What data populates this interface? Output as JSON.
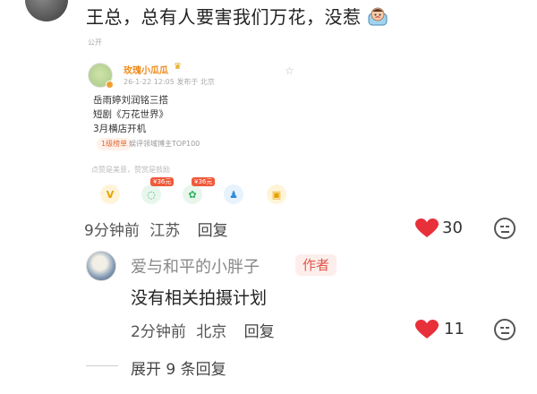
{
  "comment1": {
    "text": "王总，总有人要害我们万花，没惹",
    "time": "9分钟前",
    "location": "江苏",
    "reply_label": "回复",
    "like_count": "30"
  },
  "card": {
    "visibility": "公开",
    "user": "玫瑰小瓜瓜",
    "meta": "26-1-22 12:05 发布于 北京",
    "body_lines": [
      "岳雨婷刘润铭三搭",
      "短剧《万花世界》",
      "3月横店开机"
    ],
    "tag": "1级榜单",
    "rank": "娱评领域博主TOP100",
    "hint": "点赞是美意，赞赏是鼓励",
    "rewards": [
      {
        "icon": "v-pay-icon",
        "price": ""
      },
      {
        "icon": "wechat-icon",
        "price": "¥36元"
      },
      {
        "icon": "moments-icon",
        "price": "¥36元"
      },
      {
        "icon": "qq-icon",
        "price": ""
      },
      {
        "icon": "save-icon",
        "price": ""
      }
    ]
  },
  "comment2": {
    "username": "爱与和平的小胖子",
    "author_badge": "作者",
    "text": "没有相关拍摄计划",
    "time": "2分钟前",
    "location": "北京",
    "reply_label": "回复",
    "like_count": "11"
  },
  "expand": {
    "label": "展开 9 条回复"
  },
  "colors": {
    "heart": "#e8303a",
    "accent_orange": "#f08a1a",
    "author_badge": "#e0584a"
  }
}
